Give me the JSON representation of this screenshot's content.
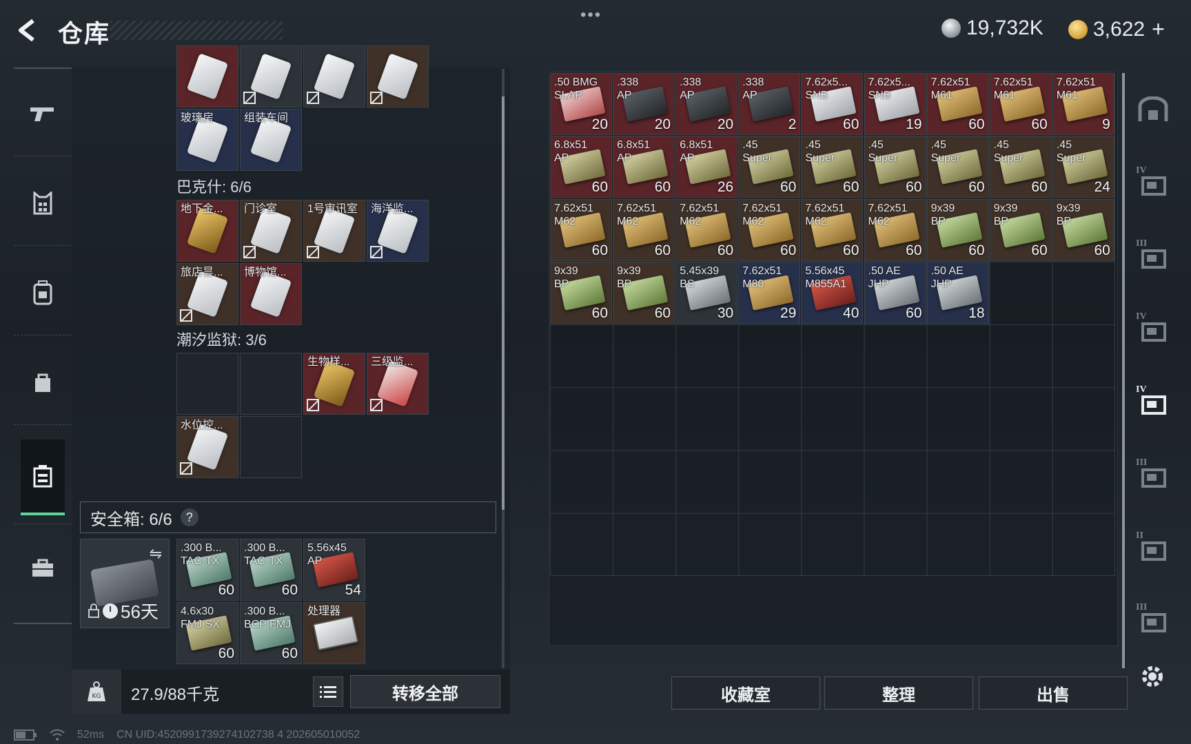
{
  "topbar": {
    "title": "仓库",
    "silver": "19,732K",
    "gold": "3,622",
    "plus": "+"
  },
  "nav": {
    "items": [
      "gun-icon",
      "armor-icon",
      "backpack-icon",
      "bag-icon",
      "safe-box-icon",
      "briefcase-icon"
    ]
  },
  "stash": {
    "bakeshi_label": "巴克什: 6/6",
    "chaoxi_label": "潮汐监狱: 3/6",
    "keys_top": [
      {
        "name": "",
        "color": "red",
        "card": "white",
        "lock": false
      },
      {
        "name": "",
        "color": "gray",
        "card": "white",
        "lock": true
      },
      {
        "name": "",
        "color": "gray",
        "card": "white",
        "lock": true
      },
      {
        "name": "",
        "color": "brown",
        "card": "white",
        "lock": true
      },
      {
        "name": "玻璃房",
        "color": "blue",
        "card": "white",
        "lock": false
      },
      {
        "name": "组装车间",
        "color": "blue",
        "card": "white",
        "lock": false
      }
    ],
    "keys_bakeshi": [
      {
        "name": "地下金...",
        "color": "red",
        "card": "gold",
        "lock": false
      },
      {
        "name": "门诊室",
        "color": "brown",
        "card": "white",
        "lock": true
      },
      {
        "name": "1号审讯室",
        "color": "brown",
        "card": "white",
        "lock": true
      },
      {
        "name": "海洋监...",
        "color": "blue",
        "card": "white",
        "lock": true
      },
      {
        "name": "旅店昙...",
        "color": "brown",
        "card": "white",
        "lock": true
      },
      {
        "name": "博物馆...",
        "color": "red",
        "card": "white",
        "lock": false
      }
    ],
    "keys_chaoxi": [
      {
        "name": "",
        "color": "empty",
        "card": "",
        "lock": false
      },
      {
        "name": "",
        "color": "empty",
        "card": "",
        "lock": false
      },
      {
        "name": "生物样...",
        "color": "red",
        "card": "gold",
        "lock": true
      },
      {
        "name": "三级监...",
        "color": "red",
        "card": "redc",
        "lock": true
      },
      {
        "name": "水位控...",
        "color": "brown",
        "card": "white",
        "lock": true
      },
      {
        "name": "",
        "color": "empty",
        "card": "",
        "lock": false
      }
    ]
  },
  "safebox": {
    "label": "安全箱: 6/6",
    "help": "?",
    "timer": "56天",
    "items": [
      {
        "name": ".300 B...\nTAC-TX",
        "count": "60",
        "color": "gray",
        "ammo": "teal"
      },
      {
        "name": ".300 B...\nTAC-TX",
        "count": "60",
        "color": "gray",
        "ammo": "teal"
      },
      {
        "name": "5.56x45\nAP",
        "count": "54",
        "color": "gray",
        "ammo": "red"
      },
      {
        "name": "4.6x30\nFMJ SX",
        "count": "60",
        "color": "gray",
        "ammo": "olive"
      },
      {
        "name": ".300 B...\nBCP FMJ",
        "count": "60",
        "color": "gray",
        "ammo": "teal"
      },
      {
        "name": "处理器",
        "count": "",
        "color": "brown",
        "ammo": "device"
      }
    ]
  },
  "weight": {
    "text": "27.9/88千克",
    "transfer": "转移全部"
  },
  "inventory": {
    "items": [
      {
        "name": ".50 BMG\nSLAP",
        "count": "20",
        "color": "red",
        "ammo": "pink"
      },
      {
        "name": ".338\nAP",
        "count": "20",
        "color": "red",
        "ammo": "dark"
      },
      {
        "name": ".338\nAP",
        "count": "20",
        "color": "red",
        "ammo": "dark"
      },
      {
        "name": ".338\nAP",
        "count": "2",
        "color": "red",
        "ammo": "dark"
      },
      {
        "name": "7.62x5...\nSNB",
        "count": "60",
        "color": "red",
        "ammo": "white"
      },
      {
        "name": "7.62x5...\nSNB",
        "count": "19",
        "color": "red",
        "ammo": "white"
      },
      {
        "name": "7.62x51\nM61",
        "count": "60",
        "color": "red",
        "ammo": "tan"
      },
      {
        "name": "7.62x51\nM61",
        "count": "60",
        "color": "red",
        "ammo": "tan"
      },
      {
        "name": "7.62x51\nM61",
        "count": "9",
        "color": "red",
        "ammo": "tan"
      },
      {
        "name": "6.8x51\nAP",
        "count": "60",
        "color": "red",
        "ammo": "olive"
      },
      {
        "name": "6.8x51\nAP",
        "count": "60",
        "color": "red",
        "ammo": "olive"
      },
      {
        "name": "6.8x51\nAP",
        "count": "26",
        "color": "red",
        "ammo": "olive"
      },
      {
        "name": ".45\nSuper",
        "count": "60",
        "color": "brown",
        "ammo": "olive"
      },
      {
        "name": ".45\nSuper",
        "count": "60",
        "color": "brown",
        "ammo": "olive"
      },
      {
        "name": ".45\nSuper",
        "count": "60",
        "color": "brown",
        "ammo": "olive"
      },
      {
        "name": ".45\nSuper",
        "count": "60",
        "color": "brown",
        "ammo": "olive"
      },
      {
        "name": ".45\nSuper",
        "count": "60",
        "color": "brown",
        "ammo": "olive"
      },
      {
        "name": ".45\nSuper",
        "count": "24",
        "color": "brown",
        "ammo": "olive"
      },
      {
        "name": "7.62x51\nM62",
        "count": "60",
        "color": "brown",
        "ammo": "tan"
      },
      {
        "name": "7.62x51\nM62",
        "count": "60",
        "color": "brown",
        "ammo": "tan"
      },
      {
        "name": "7.62x51\nM62",
        "count": "60",
        "color": "brown",
        "ammo": "tan"
      },
      {
        "name": "7.62x51\nM62",
        "count": "60",
        "color": "brown",
        "ammo": "tan"
      },
      {
        "name": "7.62x51\nM62",
        "count": "60",
        "color": "brown",
        "ammo": "tan"
      },
      {
        "name": "7.62x51\nM62",
        "count": "60",
        "color": "brown",
        "ammo": "tan"
      },
      {
        "name": "9x39\nBP",
        "count": "60",
        "color": "brown",
        "ammo": "green"
      },
      {
        "name": "9x39\nBP",
        "count": "60",
        "color": "brown",
        "ammo": "green"
      },
      {
        "name": "9x39\nBP",
        "count": "60",
        "color": "brown",
        "ammo": "green"
      },
      {
        "name": "9x39\nBP",
        "count": "60",
        "color": "brown",
        "ammo": "green"
      },
      {
        "name": "9x39\nBP",
        "count": "60",
        "color": "brown",
        "ammo": "green"
      },
      {
        "name": "5.45x39\nBS",
        "count": "30",
        "color": "gray",
        "ammo": "silver"
      },
      {
        "name": "7.62x51\nM80",
        "count": "29",
        "color": "blue",
        "ammo": "tan"
      },
      {
        "name": "5.56x45\nM855A1",
        "count": "40",
        "color": "blue",
        "ammo": "red"
      },
      {
        "name": ".50 AE\nJHP",
        "count": "60",
        "color": "blue",
        "ammo": "silver"
      },
      {
        "name": ".50 AE\nJHP",
        "count": "18",
        "color": "blue",
        "ammo": "silver"
      }
    ],
    "buttons": {
      "collection": "收藏室",
      "organize": "整理",
      "sell": "出售"
    }
  },
  "right_tabs": [
    {
      "level": "",
      "icon": "stash-home-icon",
      "active": false
    },
    {
      "level": "IV",
      "icon": "container-iv-icon",
      "active": false
    },
    {
      "level": "III",
      "icon": "container-iii-icon",
      "active": false
    },
    {
      "level": "IV",
      "icon": "container-iv-b-icon",
      "active": false
    },
    {
      "level": "IV",
      "icon": "container-iv-c-icon",
      "active": true
    },
    {
      "level": "III",
      "icon": "container-iii-b-icon",
      "active": false
    },
    {
      "level": "II",
      "icon": "container-ii-icon",
      "active": false
    },
    {
      "level": "III",
      "icon": "container-iii-c-icon",
      "active": false
    }
  ],
  "status": {
    "ping": "52ms",
    "uid": "CN UID:4520991739274102738 4  202605010052"
  }
}
